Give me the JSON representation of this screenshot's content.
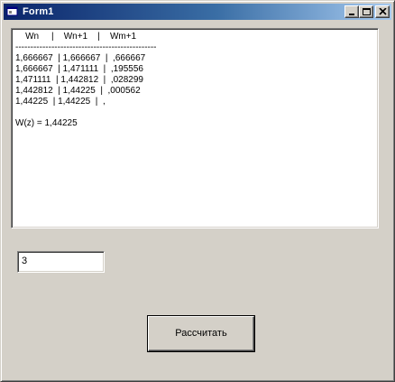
{
  "window": {
    "title": "Form1",
    "icon": "form-icon",
    "controls": {
      "minimize": "minimize-icon",
      "maximize": "maximize-icon",
      "close": "close-icon"
    }
  },
  "output": {
    "lines": [
      "    Wn     |    Wn+1    |    Wm+1",
      "-----------------------------------------------",
      "1,666667  | 1,666667  |  ,666667",
      "1,666667  | 1,471111  |  ,195556",
      "1,471111  | 1,442812  |  ,028299",
      "1,442812  | 1,44225  |  ,000562",
      "1,44225  | 1,44225  |  ,",
      "",
      "W(z) = 1,44225"
    ]
  },
  "input": {
    "value": "3"
  },
  "button": {
    "label": "Рассчитать"
  },
  "colors": {
    "window_face": "#d4d0c8",
    "title_start": "#0a246a",
    "title_end": "#a6caf0"
  }
}
